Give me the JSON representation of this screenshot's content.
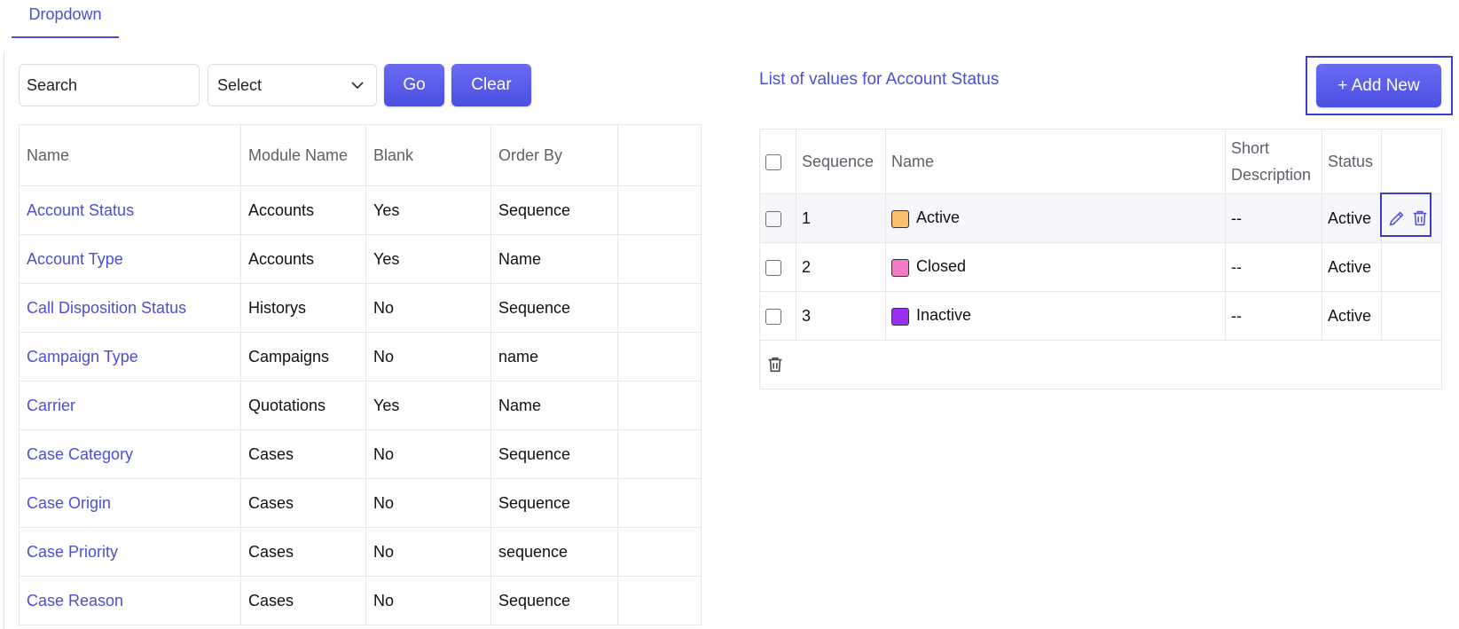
{
  "tabs": [
    {
      "label": "Dropdown",
      "active": true
    }
  ],
  "filters": {
    "search_placeholder": "Search",
    "select_value": "Select",
    "go_label": "Go",
    "clear_label": "Clear"
  },
  "left_table": {
    "columns": [
      "Name",
      "Module Name",
      "Blank",
      "Order By",
      ""
    ],
    "rows": [
      [
        "Account Status",
        "Accounts",
        "Yes",
        "Sequence"
      ],
      [
        "Account Type",
        "Accounts",
        "Yes",
        "Name"
      ],
      [
        "Call Disposition Status",
        "Historys",
        "No",
        "Sequence"
      ],
      [
        "Campaign Type",
        "Campaigns",
        "No",
        "name"
      ],
      [
        "Carrier",
        "Quotations",
        "Yes",
        "Name"
      ],
      [
        "Case Category",
        "Cases",
        "No",
        "Sequence"
      ],
      [
        "Case Origin",
        "Cases",
        "No",
        "Sequence"
      ],
      [
        "Case Priority",
        "Cases",
        "No",
        "sequence"
      ],
      [
        "Case Reason",
        "Cases",
        "No",
        "Sequence"
      ]
    ]
  },
  "right_panel": {
    "title": "List of values for Account Status",
    "add_label": "+ Add New",
    "columns": [
      "",
      "Sequence",
      "Name",
      "Short Description",
      "Status",
      ""
    ],
    "rows": [
      {
        "sequence": "1",
        "name": "Active",
        "color": "#f9c06b",
        "short_description": "--",
        "status": "Active"
      },
      {
        "sequence": "2",
        "name": "Closed",
        "color": "#f47cc6",
        "short_description": "--",
        "status": "Active"
      },
      {
        "sequence": "3",
        "name": "Inactive",
        "color": "#9b2ff0",
        "short_description": "--",
        "status": "Active"
      }
    ]
  },
  "icons": {
    "edit": "pencil-icon",
    "delete": "trash-icon",
    "bulk_delete": "trash-icon"
  },
  "colors": {
    "accent": "#4b4fd6",
    "button": "#5a5cec"
  }
}
